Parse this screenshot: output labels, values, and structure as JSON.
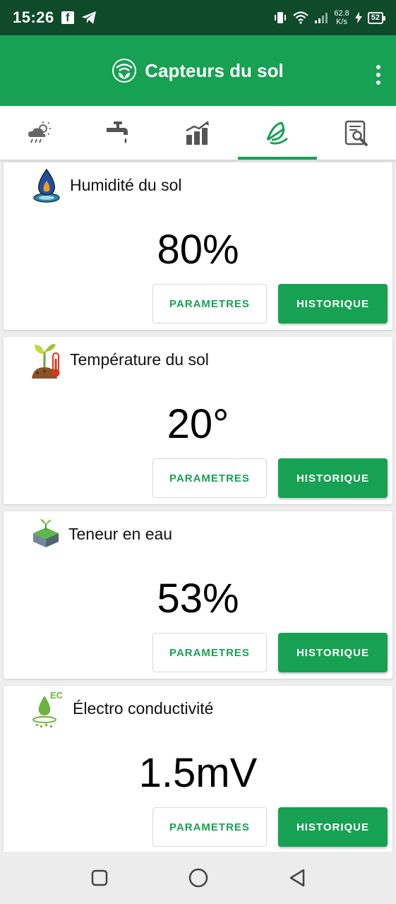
{
  "status_bar": {
    "time": "15:26",
    "net_speed_value": "62.8",
    "net_speed_unit": "K/s",
    "battery": "52"
  },
  "app_bar": {
    "title": "Capteurs du sol"
  },
  "tabs": [
    {
      "name": "weather",
      "icon": "weather-icon"
    },
    {
      "name": "irrigation",
      "icon": "faucet-icon"
    },
    {
      "name": "charts",
      "icon": "bar-chart-icon"
    },
    {
      "name": "soil-sensors",
      "icon": "soil-sensor-icon",
      "active": true
    },
    {
      "name": "settings",
      "icon": "report-wrench-icon"
    }
  ],
  "sensors": [
    {
      "label": "Humidité du sol",
      "value": "80%",
      "icon": "soil-humidity-icon",
      "params_label": "PARAMETRES",
      "history_label": "HISTORIQUE"
    },
    {
      "label": "Température du sol",
      "value": "20°",
      "icon": "soil-temperature-icon",
      "params_label": "PARAMETRES",
      "history_label": "HISTORIQUE"
    },
    {
      "label": "Teneur en eau",
      "value": "53%",
      "icon": "water-content-icon",
      "params_label": "PARAMETRES",
      "history_label": "HISTORIQUE"
    },
    {
      "label": "Électro conductivité",
      "value": "1.5mV",
      "icon": "electro-conductivity-icon",
      "params_label": "PARAMETRES",
      "history_label": "HISTORIQUE"
    }
  ],
  "colors": {
    "primary": "#17a153",
    "status_bar": "#0f4a2b"
  }
}
